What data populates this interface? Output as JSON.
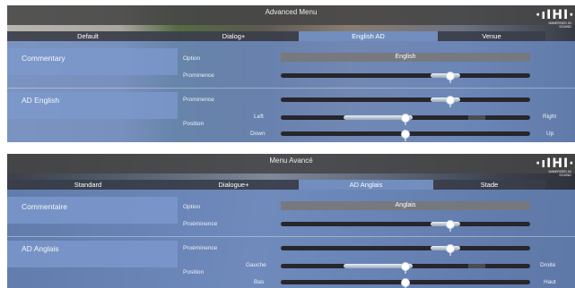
{
  "panels": [
    {
      "title": "Advanced Menu",
      "tabs": [
        "Default",
        "Dialog+",
        "English AD",
        "Venue"
      ],
      "active_tab": "English AD",
      "commentary": {
        "heading": "Commentary",
        "option_label": "Option",
        "option_value": "English",
        "prominence_label": "Prominence",
        "prominence_level": 0.68
      },
      "ad": {
        "heading": "AD English",
        "prominence_label": "Prominence",
        "prominence_level": 0.68,
        "position_label": "Position",
        "left_label": "Left",
        "right_label": "Right",
        "down_label": "Down",
        "up_label": "Up",
        "lr_level": 0.5,
        "ud_level": 0.5
      }
    },
    {
      "title": "Menu Avancé",
      "tabs": [
        "Standard",
        "Dialogue+",
        "AD Anglais",
        "Stade"
      ],
      "active_tab": "AD Anglais",
      "commentary": {
        "heading": "Commentaire",
        "option_label": "Option",
        "option_value": "Anglais",
        "prominence_label": "Proéminence",
        "prominence_level": 0.68
      },
      "ad": {
        "heading": "AD Anglais",
        "prominence_label": "Proéminence",
        "prominence_level": 0.68,
        "position_label": "Position",
        "left_label": "Gauche",
        "right_label": "Droite",
        "down_label": "Bas",
        "up_label": "Haut",
        "lr_level": 0.5,
        "ud_level": 0.5
      }
    }
  ],
  "logo": {
    "mark": "·ıIHI·",
    "tagline": "IMMERSED IN SOUND"
  },
  "colors": {
    "panel_blue": "#6c8bc4",
    "active_tab": "#7694c8",
    "tab_bar": "#3a3e4b",
    "top_bar": "#464646"
  }
}
